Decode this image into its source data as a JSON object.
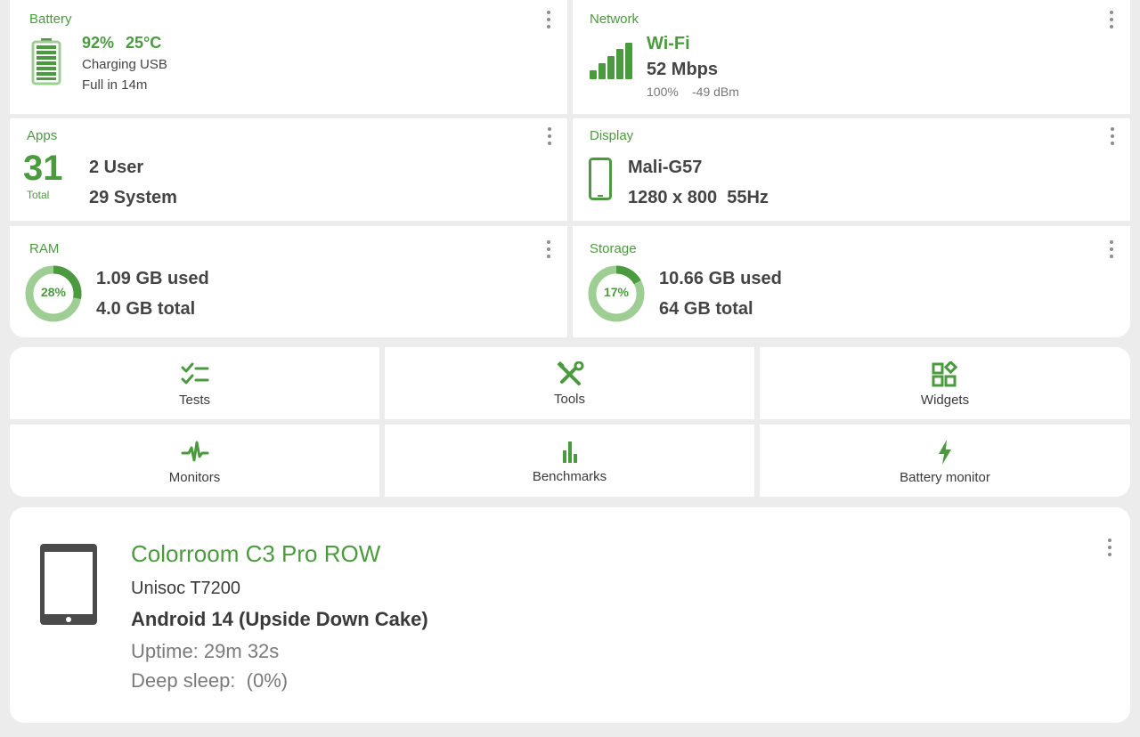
{
  "battery": {
    "title": "Battery",
    "level": "92%",
    "temp": "25°C",
    "status": "Charging USB",
    "eta": "Full in 14m"
  },
  "network": {
    "title": "Network",
    "type": "Wi-Fi",
    "speed": "52 Mbps",
    "signal_pct": "100%",
    "dbm": "-49 dBm"
  },
  "apps": {
    "title": "Apps",
    "total": "31",
    "total_label": "Total",
    "user": "2 User",
    "system": "29 System"
  },
  "display": {
    "title": "Display",
    "gpu": "Mali-G57",
    "resolution": "1280 x 800  55Hz"
  },
  "ram": {
    "title": "RAM",
    "percent_label": "28%",
    "percent": 28,
    "used": "1.09 GB used",
    "total": "4.0 GB total"
  },
  "storage": {
    "title": "Storage",
    "percent_label": "17%",
    "percent": 17,
    "used": "10.66 GB used",
    "total": "64 GB total"
  },
  "tools": [
    {
      "label": "Tests",
      "icon": "checklist-icon"
    },
    {
      "label": "Tools",
      "icon": "tools-icon"
    },
    {
      "label": "Widgets",
      "icon": "widgets-icon"
    },
    {
      "label": "Monitors",
      "icon": "pulse-icon"
    },
    {
      "label": "Benchmarks",
      "icon": "bar-chart-icon"
    },
    {
      "label": "Battery monitor",
      "icon": "bolt-icon"
    }
  ],
  "device": {
    "name": "Colorroom C3 Pro ROW",
    "soc": "Unisoc T7200",
    "android": "Android 14 (Upside Down Cake)",
    "uptime": "Uptime: 29m 32s",
    "deep_sleep": "Deep sleep:  (0%)"
  },
  "colors": {
    "accent": "#4c9a3f",
    "accent_light": "#9fce94",
    "background": "#ececec",
    "card": "#ffffff"
  }
}
